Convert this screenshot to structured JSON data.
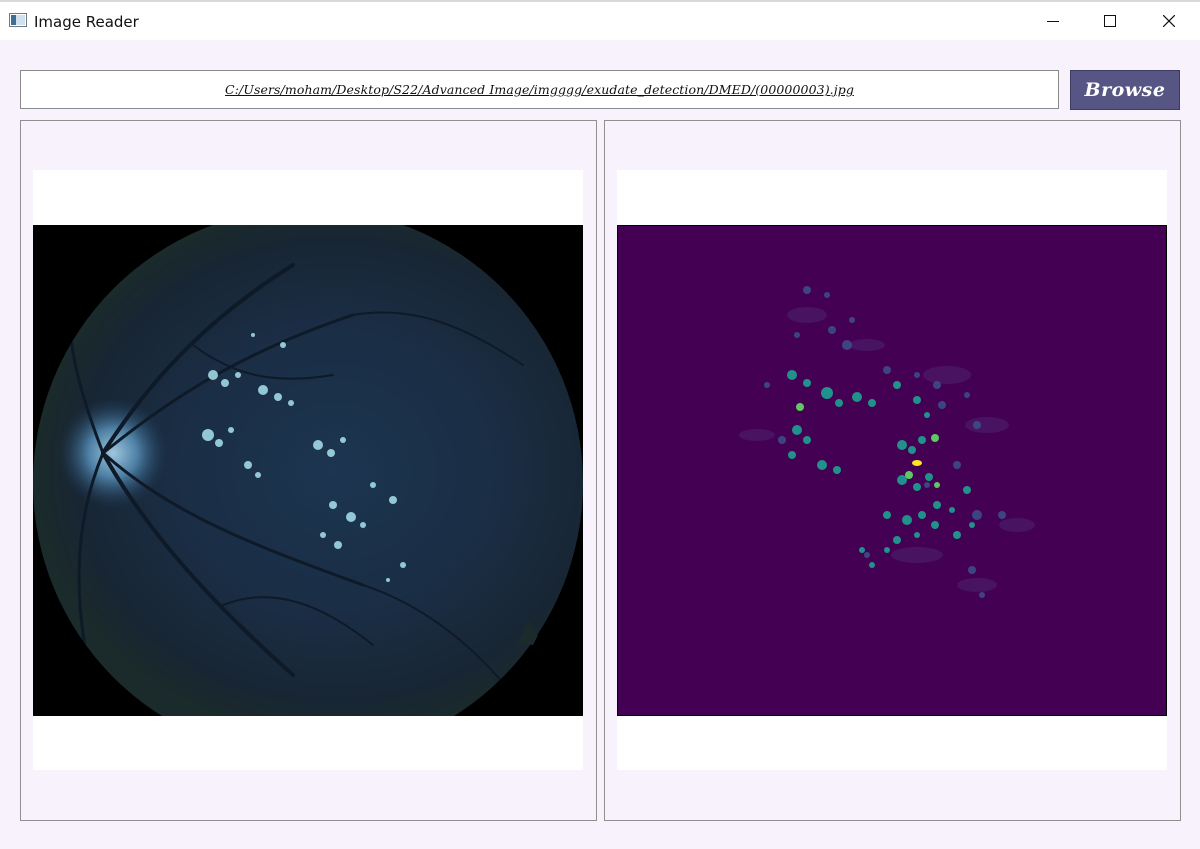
{
  "window": {
    "title": "Image Reader",
    "app_icon": "image-window-icon",
    "controls": [
      "minimize-icon",
      "maximize-icon",
      "close-icon"
    ]
  },
  "toolbar": {
    "file_path": "C:/Users/moham/Desktop/S22/Advanced Image/imgggg/exudate_detection/DMED/(00000003).jpg",
    "browse_label": "Browse"
  },
  "panels": {
    "left": {
      "content": "retinal fundus photograph (original)"
    },
    "right": {
      "content": "exudate detection map (viridis colormap)"
    }
  },
  "colors": {
    "window_bg": "#f8f2fc",
    "browse_button": "#565583",
    "map_background": "#440154",
    "map_teal": "#21918c",
    "map_green": "#5ec962",
    "map_yellow": "#fde725"
  }
}
